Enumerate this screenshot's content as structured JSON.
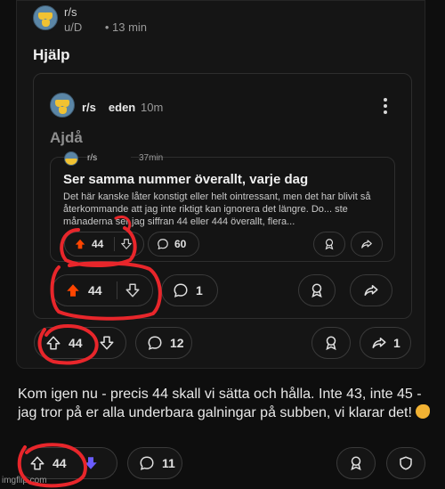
{
  "post": {
    "subreddit": "r/s",
    "user": "u/D",
    "time": "• 13 min",
    "title": "Hjälp",
    "actions": {
      "upvotes": "44",
      "comments": "12",
      "shares": "1"
    }
  },
  "crosspost": {
    "subreddit": "r/s",
    "subreddit_tail": "eden",
    "time": "10m",
    "title": "Ajdå",
    "actions": {
      "upvotes": "44",
      "comments": "1"
    }
  },
  "original_post": {
    "subreddit": "r/s",
    "time": "37min",
    "title": "Ser samma nummer överallt, varje dag",
    "body": "Det här kanske låter konstigt eller helt ointressant, men det har blivit så återkommande att jag inte riktigt kan ignorera det längre. Do... ste månaderna ser jag siffran 44 eller 444 överallt, flera...",
    "actions": {
      "upvotes": "44",
      "comments": "60"
    }
  },
  "comment": {
    "text": "Kom igen nu - precis 44 skall vi sätta och hålla. Inte 43, inte 45 - jag tror på er alla underbara galningar på subben, vi klarar det!",
    "actions": {
      "upvotes": "44",
      "comments": "11"
    }
  },
  "watermark": "imgflip.com",
  "colors": {
    "upvote_orange": "#ff4500",
    "downvote_purple": "#6a5cff",
    "scribble_red": "#e8262b"
  }
}
